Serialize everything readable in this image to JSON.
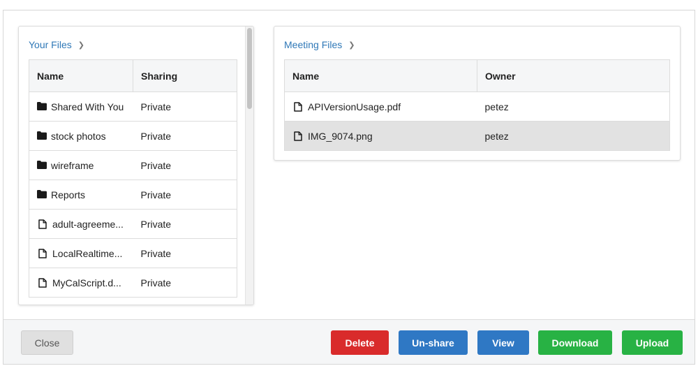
{
  "left_panel": {
    "breadcrumb": "Your Files",
    "columns": [
      "Name",
      "Sharing"
    ],
    "rows": [
      {
        "type": "folder",
        "name": "Shared With You",
        "sharing": "Private"
      },
      {
        "type": "folder",
        "name": "stock photos",
        "sharing": "Private"
      },
      {
        "type": "folder",
        "name": "wireframe",
        "sharing": "Private"
      },
      {
        "type": "folder",
        "name": "Reports",
        "sharing": "Private"
      },
      {
        "type": "file",
        "name": "adult-agreeme...",
        "sharing": "Private"
      },
      {
        "type": "file",
        "name": "LocalRealtime...",
        "sharing": "Private"
      },
      {
        "type": "file",
        "name": "MyCalScript.d...",
        "sharing": "Private"
      }
    ]
  },
  "right_panel": {
    "breadcrumb": "Meeting Files",
    "columns": [
      "Name",
      "Owner"
    ],
    "rows": [
      {
        "type": "file",
        "name": "APIVersionUsage.pdf",
        "owner": "petez",
        "selected": false
      },
      {
        "type": "file",
        "name": "IMG_9074.png",
        "owner": "petez",
        "selected": true
      }
    ]
  },
  "footer": {
    "close_label": "Close",
    "delete_label": "Delete",
    "unshare_label": "Un-share",
    "view_label": "View",
    "download_label": "Download",
    "upload_label": "Upload"
  },
  "colors": {
    "link": "#2f78b7",
    "delete": "#d92b2b",
    "primary": "#2f78c4",
    "success": "#28b244",
    "selected_row": "#e2e2e2"
  },
  "icons": {
    "breadcrumb_separator": "chevron-right-icon",
    "folder": "folder-icon",
    "file": "file-icon"
  }
}
